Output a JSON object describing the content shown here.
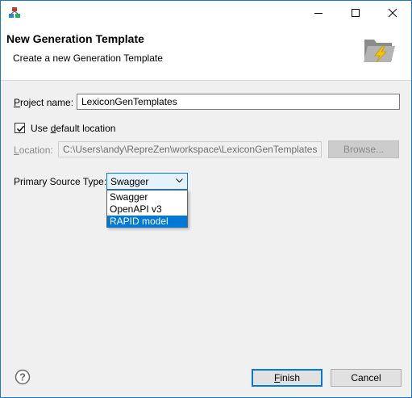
{
  "window": {
    "minimize_icon": "minimize-icon",
    "maximize_icon": "maximize-icon",
    "close_icon": "close-icon"
  },
  "banner": {
    "title": "New Generation Template",
    "subtitle": "Create a new Generation Template",
    "image_icon": "folder-lightning-icon"
  },
  "project": {
    "label_mnemonic": "P",
    "label_rest": "roject name:",
    "value": "LexiconGenTemplates"
  },
  "default_location": {
    "checked": true,
    "label_pre": "Use ",
    "label_mnemonic": "d",
    "label_post": "efault location"
  },
  "location": {
    "label_mnemonic": "L",
    "label_rest": "ocation:",
    "value": "C:\\Users\\andy\\RepreZen\\workspace\\LexiconGenTemplates",
    "browse_label": "Browse...",
    "enabled": false
  },
  "source_type": {
    "label": "Primary Source Type:",
    "selected": "Swagger",
    "options": [
      "Swagger",
      "OpenAPI v3",
      "RAPID model"
    ],
    "highlighted": "RAPID model"
  },
  "footer": {
    "help_icon": "help-icon",
    "finish_mnemonic": "F",
    "finish_rest": "inish",
    "cancel_label": "Cancel"
  },
  "colors": {
    "accent": "#0078d7",
    "window_border": "#1e78c8"
  }
}
